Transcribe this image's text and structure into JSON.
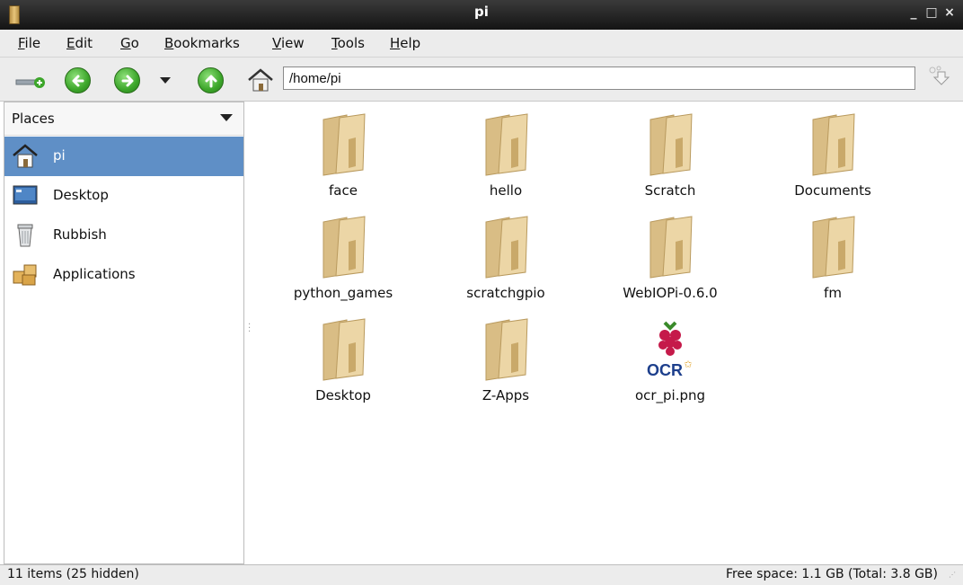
{
  "window": {
    "title": "pi",
    "minimize": "_",
    "maximize": "□",
    "close": "×"
  },
  "menu": [
    {
      "key": "F",
      "rest": "ile"
    },
    {
      "key": "E",
      "rest": "dit"
    },
    {
      "key": "G",
      "rest": "o"
    },
    {
      "key": "B",
      "rest": "ookmarks"
    },
    {
      "key": "V",
      "rest": "iew"
    },
    {
      "key": "T",
      "rest": "ools"
    },
    {
      "key": "H",
      "rest": "elp"
    }
  ],
  "location": {
    "path": "/home/pi"
  },
  "sidebar": {
    "header": "Places",
    "items": [
      {
        "label": "pi",
        "icon": "home-icon",
        "selected": true
      },
      {
        "label": "Desktop",
        "icon": "desktop-icon",
        "selected": false
      },
      {
        "label": "Rubbish",
        "icon": "trash-icon",
        "selected": false
      },
      {
        "label": "Applications",
        "icon": "applications-icon",
        "selected": false
      }
    ]
  },
  "files": [
    {
      "name": "face",
      "type": "folder"
    },
    {
      "name": "hello",
      "type": "folder"
    },
    {
      "name": "Scratch",
      "type": "folder"
    },
    {
      "name": "Documents",
      "type": "folder"
    },
    {
      "name": "python_games",
      "type": "folder"
    },
    {
      "name": "scratchgpio",
      "type": "folder"
    },
    {
      "name": "WebIOPi-0.6.0",
      "type": "folder"
    },
    {
      "name": "fm",
      "type": "folder"
    },
    {
      "name": "Desktop",
      "type": "folder"
    },
    {
      "name": "Z-Apps",
      "type": "folder"
    },
    {
      "name": "ocr_pi.png",
      "type": "image",
      "thumbnail_text": "OCR"
    }
  ],
  "status": {
    "items": "11 items (25 hidden)",
    "free_space": "Free space: 1.1 GB (Total: 3.8 GB)"
  },
  "colors": {
    "selection": "#5f8fc6",
    "titlebar": "#1e1e1e",
    "folder": "#e9cf98"
  }
}
